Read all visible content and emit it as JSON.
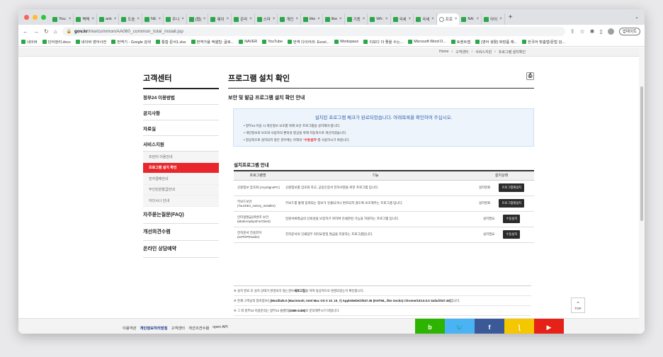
{
  "browser": {
    "tabs": [
      {
        "label": "You:",
        "active": false
      },
      {
        "label": "택택",
        "active": false
      },
      {
        "label": "ank",
        "active": false
      },
      {
        "label": "도송",
        "active": false
      },
      {
        "label": "NE",
        "active": false
      },
      {
        "label": "주니",
        "active": false
      },
      {
        "label": "[협]",
        "active": false
      },
      {
        "label": "웨이",
        "active": false
      },
      {
        "label": "온라",
        "active": false
      },
      {
        "label": "스마",
        "active": false
      },
      {
        "label": "개인",
        "active": false
      },
      {
        "label": "like",
        "active": false
      },
      {
        "label": "like",
        "active": false
      },
      {
        "label": "기종",
        "active": false
      },
      {
        "label": "Wh:",
        "active": false
      },
      {
        "label": "국세",
        "active": false
      },
      {
        "label": "국세",
        "active": false
      },
      {
        "label": "프로",
        "active": true
      },
      {
        "label": "NA:",
        "active": false
      },
      {
        "label": "아이",
        "active": false
      }
    ],
    "url_domain": "gov.kr",
    "url_path": "/mw/common/AA060_common_total_install.jsp",
    "update_label": "업데이트",
    "bookmarks": [
      "네이버",
      "단어정리.docx",
      "네이버 영어사전",
      "번역기 - Google 검색",
      "통합 문서1.xlsx",
      "번역가용 엑셀팁: 글로...",
      "NAVER",
      "YouTube",
      "번역 다이어리: Excel...",
      "Workspace",
      "이보다 더 좋을 수는...",
      "Microsoft Word O...",
      "토렌트맵",
      "[영어 생활] 화장품 제...",
      "한국어 맞춤법/문법 검..."
    ]
  },
  "breadcrumb": [
    "Home",
    "고객센터",
    "서비스지원",
    "프로그램 설치확인"
  ],
  "sidebar": {
    "title": "고객센터",
    "items": [
      {
        "label": "정부24 이용방법"
      },
      {
        "label": "공지사항"
      },
      {
        "label": "자료실"
      },
      {
        "label": "서비스지원"
      }
    ],
    "subitems": [
      {
        "label": "프린터 이용안내",
        "active": false
      },
      {
        "label": "프로그램 설치 확인",
        "active": true
      },
      {
        "label": "전자결제안내",
        "active": false
      },
      {
        "label": "무인민원발급안내",
        "active": false
      },
      {
        "label": "아다시나 안내",
        "active": false
      }
    ],
    "bottom_items": [
      {
        "label": "자주묻는질문(FAQ)"
      },
      {
        "label": "개선의견수렴"
      },
      {
        "label": "온라인 상담예약"
      }
    ]
  },
  "main": {
    "title": "프로그램 설치 확인",
    "subtitle": "보안 및 발급 프로그램 설치 확인 안내",
    "info_heading": "설치된 프로그램 체크가 완료되었습니다. 아래목록을 확인하여 주십시오.",
    "info_items": [
      {
        "pre": "정부24 이용 시 개인정보 보호를 위해 보안 프로그램을 설치해야 합니다.",
        "hl": "",
        "post": ""
      },
      {
        "pre": "개인정보의 보호와 사용자의 편의성 향상을 위해 자동적으로 개선하겠습니다.",
        "hl": "",
        "post": ""
      },
      {
        "pre": "정상적으로 설치되지 않은 경우에는 아래의 ",
        "hl": "\"수동설치\"",
        "post": "를 사용하시기 바랍니다."
      }
    ],
    "section_title": "설치프로그램 안내",
    "table_headers": [
      "프로그램명",
      "기능",
      "설치상태"
    ],
    "rows": [
      {
        "name": "신원정보 암호화 (AnySign4PC)",
        "desc": "신원정보를 암호화 하고, 공동인증서 전자서명을 위한 프로그램 입니다.",
        "status": "설치완료",
        "button": "프로그램재설치"
      },
      {
        "name": "키보드보안 (TouchEn_nxKey_Installer)",
        "desc": "키보드를 통해 입력되는 정보가 유출되거나 변조되지 않도록 보호해주는 프로그램 입니다.",
        "status": "설치완료",
        "button": "프로그램재설치"
      },
      {
        "name": "인터넷발급(위변조 보안(MarkAnyEpsForClient)",
        "desc": "민원서류발급의 신뢰성을 보장하기 위하여 인쇄관련 기능을 지원하는 프로그램 입니다.",
        "status": "설치필요",
        "button": "수동설치"
      },
      {
        "name": "전자문서 전용뷰어 (ezPDFReader)",
        "desc": "전자문서의 인쇄업무 처리요청및 발급을 지원하는 프로그램입니다.",
        "status": "설치필요",
        "button": "수동설치"
      }
    ]
  },
  "notes": [
    {
      "pre": "※  설치 완료 후 설치 상태가 변경되지 않는경우 ",
      "bold": "새로고침",
      "post": "을 하여 정상적으로 변경되었는지 확인합니다."
    },
    {
      "pre": "※  현재 고객님의 접속정보는 ",
      "bold": "[Mozilla/5.0 (Macintosh; Intel Mac OS X 10_15_7) AppleWebKit/537.36 (KHTML, like Gecko) Chrome/103.0.0.0 Safari/537.36]",
      "post": " 입니다."
    },
    {
      "pre": "※  그 외 정부24 이용문의는 정부24 콜센터 ",
      "bold": "(1588-2188)",
      "post": "로 문의해주시기 바랍니다."
    }
  ],
  "top_label": "TOP",
  "footer": {
    "links": [
      {
        "label": "이용약관",
        "hl": false
      },
      {
        "label": "개인정보처리방침",
        "hl": true
      },
      {
        "label": "고객센터",
        "hl": false
      },
      {
        "label": "개선의견수렴",
        "hl": false
      },
      {
        "label": "open API",
        "hl": false
      }
    ],
    "social": [
      {
        "icon": "blog-icon",
        "glyph": "b",
        "color": "#2db400"
      },
      {
        "icon": "twitter-icon",
        "glyph": "🐦",
        "color": "#4ab3f4"
      },
      {
        "icon": "facebook-icon",
        "glyph": "f",
        "color": "#3b5998"
      },
      {
        "icon": "kakao-icon",
        "glyph": "ƪ",
        "color": "#f4c700"
      },
      {
        "icon": "youtube-icon",
        "glyph": "▶",
        "color": "#e62117"
      }
    ]
  }
}
